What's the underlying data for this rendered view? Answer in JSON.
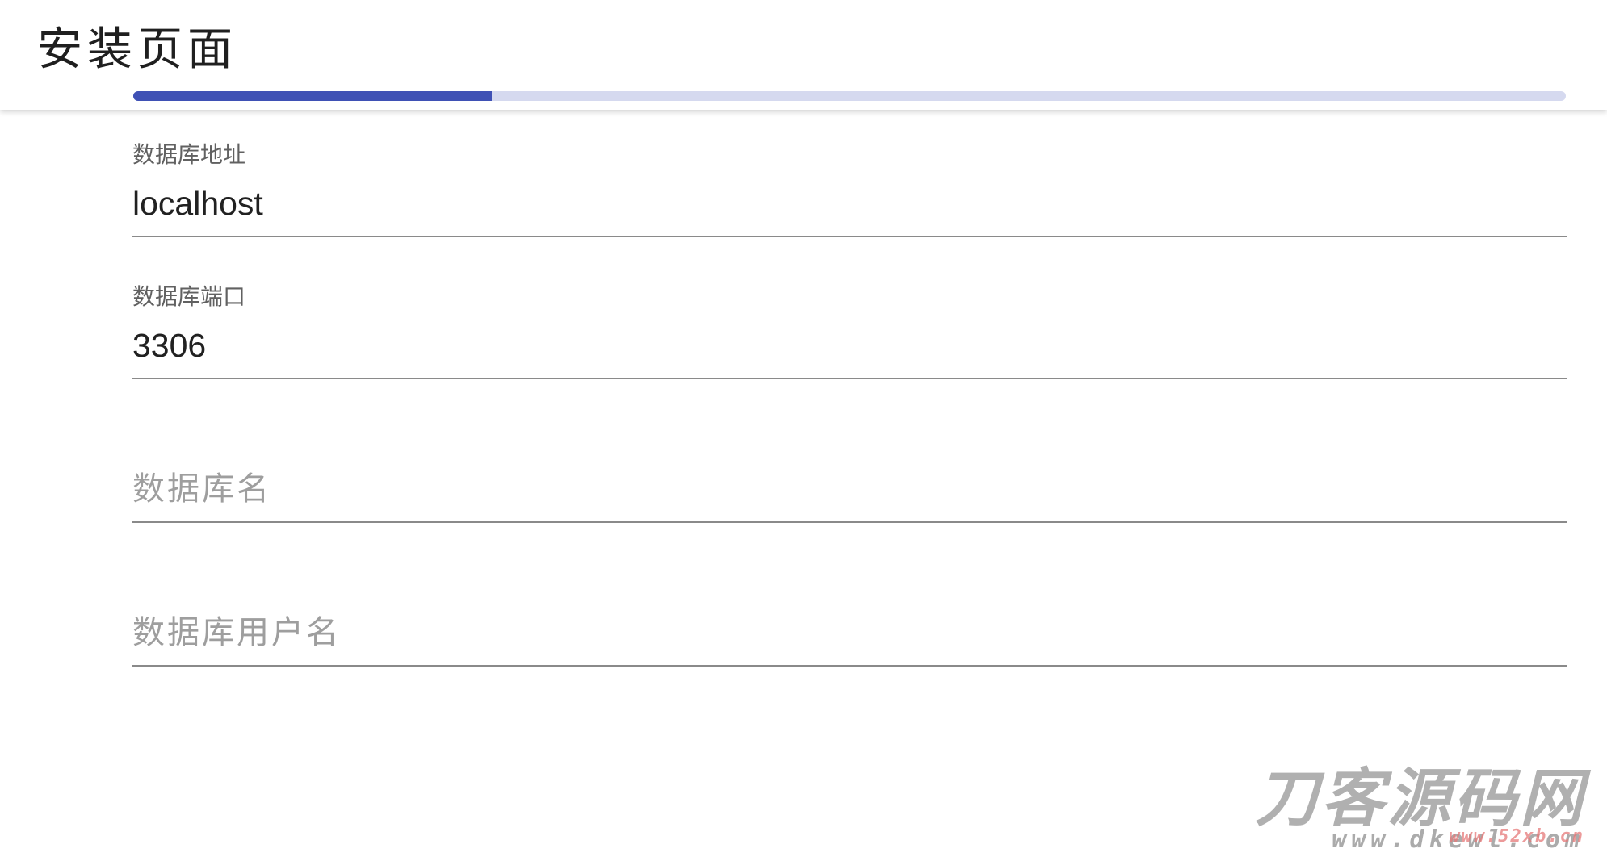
{
  "header": {
    "title": "安装页面",
    "progress": 0.25,
    "accent_color": "#3f51b5",
    "track_color": "#d5d9ef"
  },
  "form": {
    "fields": [
      {
        "label": "数据库地址",
        "value": "localhost"
      },
      {
        "label": "数据库端口",
        "value": "3306"
      },
      {
        "label": "数据库名",
        "value": ""
      },
      {
        "label": "数据库用户名",
        "value": ""
      }
    ]
  },
  "watermark": {
    "title": "刀客源码网",
    "url": "www.dkewl.com",
    "overlay_url": "www.52xb.cn"
  }
}
